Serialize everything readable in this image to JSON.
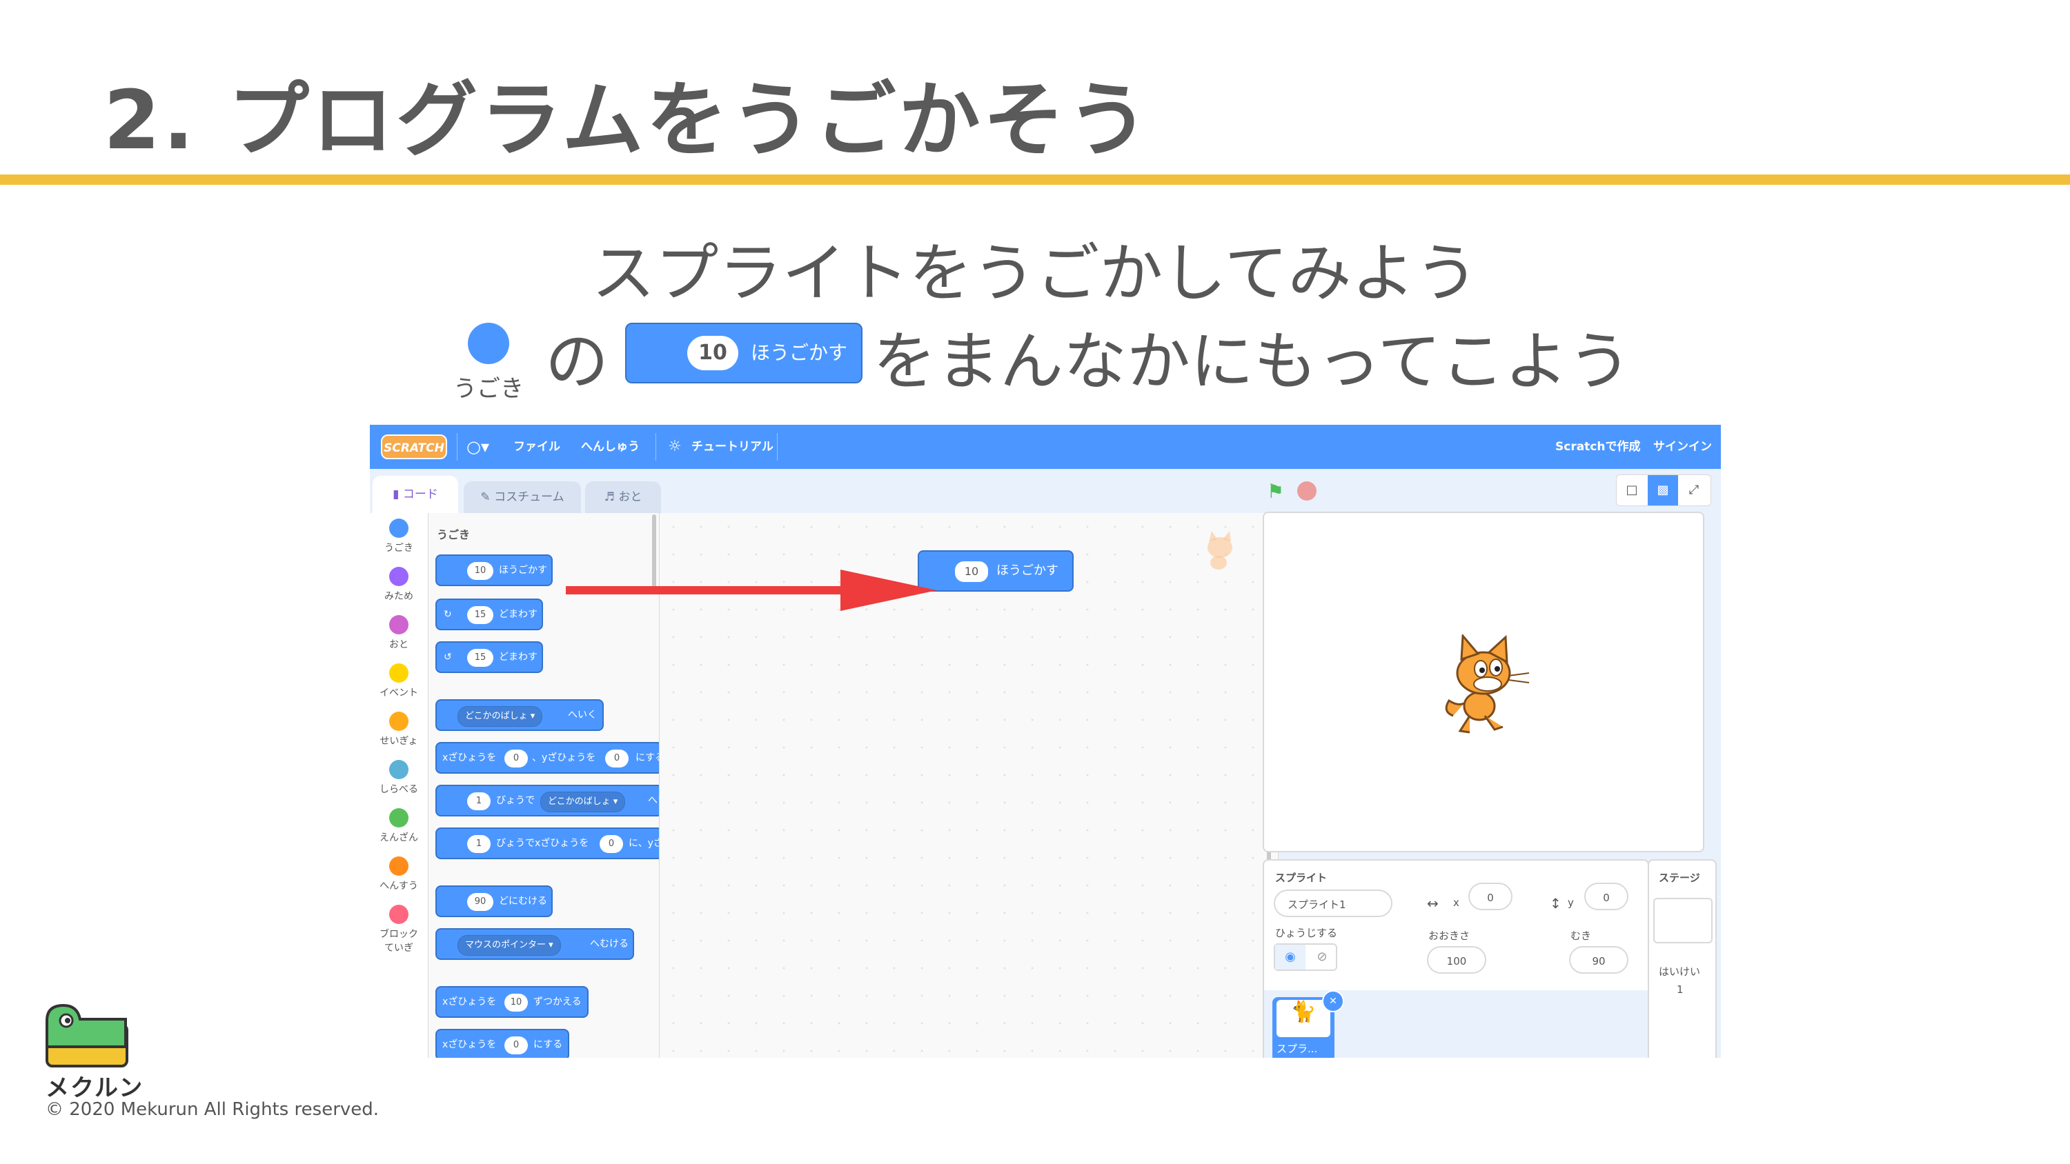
{
  "slide": {
    "title": "2. プログラムをうごかそう",
    "subtitle": "スプライトをうごかしてみよう",
    "instruction_no": "の",
    "instruction_rest": "をまんなかにもってこよう",
    "motion_category_label": "うごき",
    "move_block": {
      "value": "10",
      "label": "ほうごかす"
    },
    "accent_color": "#f2bf3c"
  },
  "editor": {
    "menu": {
      "logo": "SCRATCH",
      "file": "ファイル",
      "edit": "へんしゅう",
      "tutorials": "チュートリアル",
      "create_in_scratch": "Scratchで作成",
      "sign_in": "サインイン"
    },
    "tabs": {
      "code": "コード",
      "costumes": "コスチューム",
      "sounds": "おと"
    },
    "categories": [
      {
        "label": "うごき",
        "color": "#4c97ff"
      },
      {
        "label": "みため",
        "color": "#9966ff"
      },
      {
        "label": "おと",
        "color": "#cf63cf"
      },
      {
        "label": "イベント",
        "color": "#ffd500"
      },
      {
        "label": "せいぎょ",
        "color": "#ffab19"
      },
      {
        "label": "しらべる",
        "color": "#5cb1d6"
      },
      {
        "label": "えんざん",
        "color": "#59c059"
      },
      {
        "label": "へんすう",
        "color": "#ff8c1a"
      },
      {
        "label": "ブロックていぎ",
        "color": "#ff6680"
      }
    ],
    "palette": {
      "heading": "うごき",
      "move": {
        "value": "10",
        "label": "ほうごかす"
      },
      "turn_right": {
        "value": "15",
        "label": "どまわす"
      },
      "turn_left": {
        "value": "15",
        "label": "どまわす"
      },
      "goto": {
        "dropdown": "どこかのばしょ",
        "label": "へいく"
      },
      "goto_xy": {
        "label1": "xざひょうを",
        "x": "0",
        "label2": "、yざひょうを",
        "y": "0",
        "label3": "にする"
      },
      "glide": {
        "value": "1",
        "label1": "びょうで",
        "dropdown": "どこかのばしょ",
        "label2": "へい"
      },
      "glide_xy": {
        "value": "1",
        "label1": "びょうでxざひょうを",
        "x": "0",
        "label2": "に、yざ"
      },
      "point_dir": {
        "value": "90",
        "label": "どにむける"
      },
      "point_towards": {
        "dropdown": "マウスのポインター",
        "label": "へむける"
      },
      "change_x": {
        "label1": "xざひょうを",
        "value": "10",
        "label2": "ずつかえる"
      },
      "set_x": {
        "label1": "xざひょうを",
        "value": "0",
        "label2": "にする"
      }
    },
    "workspace_block": {
      "value": "10",
      "label": "ほうごかす"
    },
    "sprite_info": {
      "sprite_label": "スプライト",
      "sprite_name": "スプライト1",
      "x_label": "x",
      "x": "0",
      "y_label": "y",
      "y": "0",
      "show_label": "ひょうじする",
      "size_label": "おおきさ",
      "size": "100",
      "direction_label": "むき",
      "direction": "90",
      "thumb_label": "スプラ..."
    },
    "stage_panel": {
      "title": "ステージ",
      "backdrops_label": "はいけい",
      "backdrops_count": "1"
    }
  },
  "footer": {
    "brand": "メクルン",
    "copyright": "© 2020 Mekurun All Rights reserved."
  }
}
